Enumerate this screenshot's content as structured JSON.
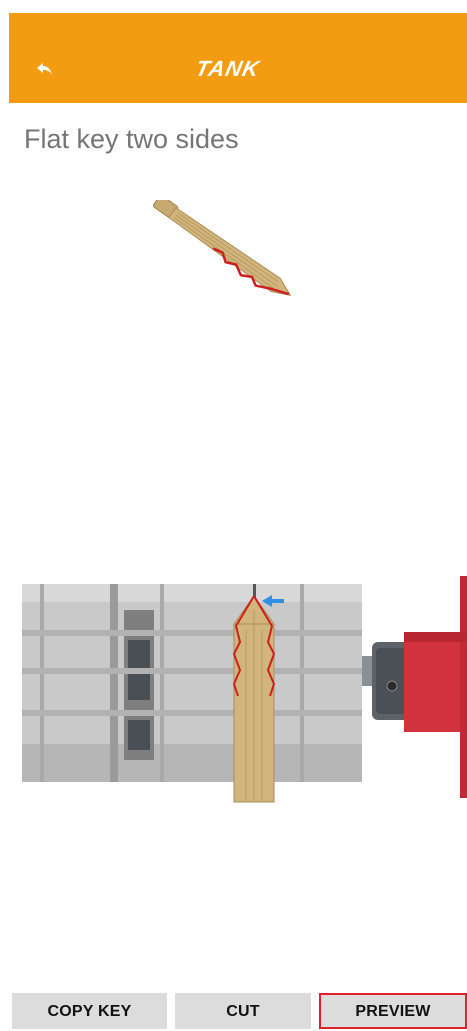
{
  "header": {
    "logo_text": "TANK",
    "back_icon": "back-arrow-icon",
    "accent_color": "#f39c12"
  },
  "page_title": "Flat key two sides",
  "illustrations": {
    "key_preview_icon": "flat-key-icon",
    "machine_icon": "key-cutting-machine-icon",
    "indicator_icon": "blue-arrow-icon",
    "cut_outline_color": "#cc1f1f"
  },
  "actions": {
    "copy_key_label": "COPY KEY",
    "cut_label": "CUT",
    "preview_label": "PREVIEW",
    "selected_outline_color": "#e0202c"
  }
}
